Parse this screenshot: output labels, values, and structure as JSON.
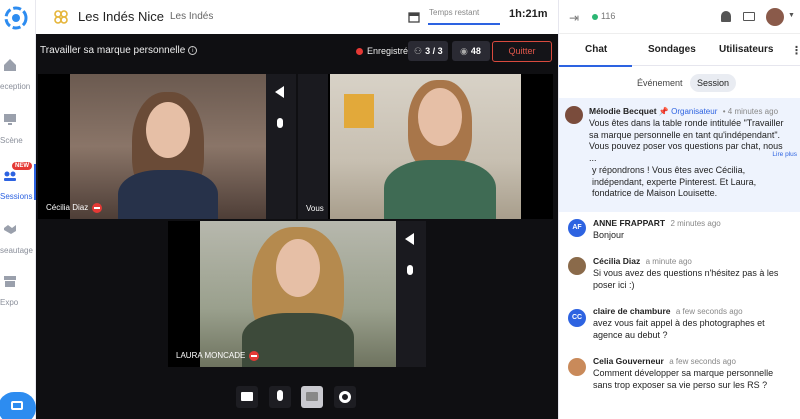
{
  "nav": {
    "items": [
      {
        "label": "eception",
        "icon": "home-icon"
      },
      {
        "label": "Scène",
        "icon": "screen-icon"
      },
      {
        "label": "Sessions",
        "icon": "session-icon",
        "badge": "NEW"
      },
      {
        "label": "seautage",
        "icon": "handshake-icon"
      },
      {
        "label": "Expo",
        "icon": "store-icon"
      }
    ]
  },
  "header": {
    "org_name": "Les Indés Nice",
    "org_sub": "Les Indés",
    "time_label": "Temps restant",
    "time_value": "1h:21m"
  },
  "stage": {
    "title": "Travailler sa marque personnelle",
    "recording": "Enregistré",
    "participants": "3 / 3",
    "viewers": "48",
    "quit_label": "Quitter",
    "tiles": [
      {
        "name": "Cécilia Diaz"
      },
      {
        "name": "Vous"
      },
      {
        "name": "LAURA MONCADE"
      }
    ]
  },
  "panel": {
    "online_count": "116",
    "tabs": [
      "Chat",
      "Sondages",
      "Utilisateurs"
    ],
    "subtabs": [
      "Événement",
      "Session"
    ],
    "pinned": {
      "author": "Mélodie Becquet",
      "tag": "Organisateur",
      "time": "4 minutes ago",
      "text": "Vous êtes dans la table ronde intitulée \"Travailler sa marque personnelle en tant qu'indépendant\". Vous pouvez poser vos questions par chat, nous ...",
      "read_more": "Lire plus",
      "continuation": "y répondrons ! Vous êtes avec Cécilia, indépendant, experte Pinterest. Et Laura, fondatrice de Maison Louisette."
    },
    "messages": [
      {
        "author": "ANNE FRAPPART",
        "initials": "AF",
        "time": "2 minutes ago",
        "text": "Bonjour"
      },
      {
        "author": "Cécilia Diaz",
        "initials": "",
        "time": "a minute ago",
        "text": "Si vous avez des questions n'hésitez pas à les poser ici :)"
      },
      {
        "author": "claire de chambure",
        "initials": "CC",
        "time": "a few seconds ago",
        "text": "avez vous fait appel à des photographes et agence au debut ?"
      },
      {
        "author": "Celia Gouverneur",
        "initials": "",
        "time": "a few seconds ago",
        "text": "Comment développer sa marque personnelle sans trop exposer sa vie perso sur les RS ?"
      }
    ]
  },
  "colors": {
    "accent": "#2d63e1",
    "danger": "#e53935",
    "online": "#2bb673"
  }
}
